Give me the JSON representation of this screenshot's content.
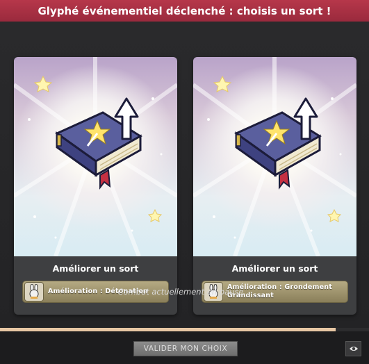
{
  "header": {
    "title": "Glyphé événementiel déclenché : choisis un sort !"
  },
  "cards": [
    {
      "illustration_icon": "spellbook-upgrade-icon",
      "title": "Améliorer un sort",
      "spell_icon": "bunny-mage-icon",
      "spell_label_line1": "Amélioration : Détonation",
      "spell_label_line2": ""
    },
    {
      "illustration_icon": "spellbook-upgrade-icon",
      "title": "Améliorer un sort",
      "spell_icon": "bunny-mage-icon",
      "spell_label_line1": "Amélioration : Grondement",
      "spell_label_line2": "Grandissant"
    }
  ],
  "status": {
    "pause_text": "Combat actuellement en pause..."
  },
  "progress": {
    "fraction": 0.91,
    "color": "#e7c7a4"
  },
  "footer": {
    "validate_label": "VALIDER MON CHOIX",
    "toggle_icon": "eye-icon"
  },
  "colors": {
    "header": "#a8304a",
    "pill": "#a89c72"
  }
}
